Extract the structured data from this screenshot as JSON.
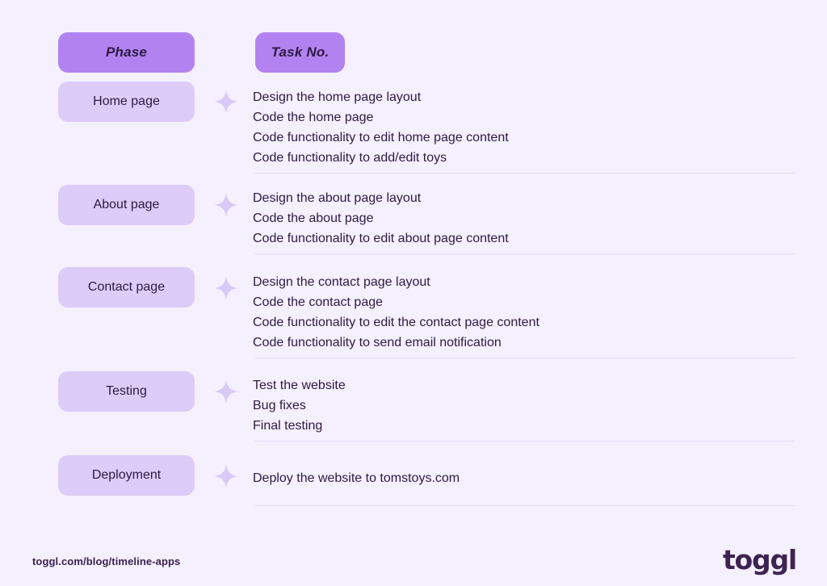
{
  "page": {
    "background_color": "#f5f0fe",
    "text_color": "#2e1a42"
  },
  "header": {
    "phase_label": "Phase",
    "task_label": "Task No.",
    "accent_color": "#b283f0"
  },
  "sparkle_icon": "sparkle-four-point-star",
  "rows": [
    {
      "phase": "Home page",
      "tasks": [
        "Design the home page layout",
        "Code the home page",
        "Code functionality to edit home page content",
        "Code functionality to add/edit toys"
      ]
    },
    {
      "phase": "About page",
      "tasks": [
        "Design the about page layout",
        "Code the about page",
        "Code functionality to edit about page content"
      ]
    },
    {
      "phase": "Contact page",
      "tasks": [
        "Design the contact page layout",
        "Code the contact page",
        "Code functionality to edit the contact page content",
        "Code functionality to send email notification"
      ]
    },
    {
      "phase": "Testing",
      "tasks": [
        "Test the website",
        "Bug fixes",
        "Final testing"
      ]
    },
    {
      "phase": "Deployment",
      "tasks": [
        "Deploy the website to tomstoys.com"
      ]
    }
  ],
  "footer": {
    "url": "toggl.com/blog/timeline-apps",
    "logo": "toggl"
  }
}
